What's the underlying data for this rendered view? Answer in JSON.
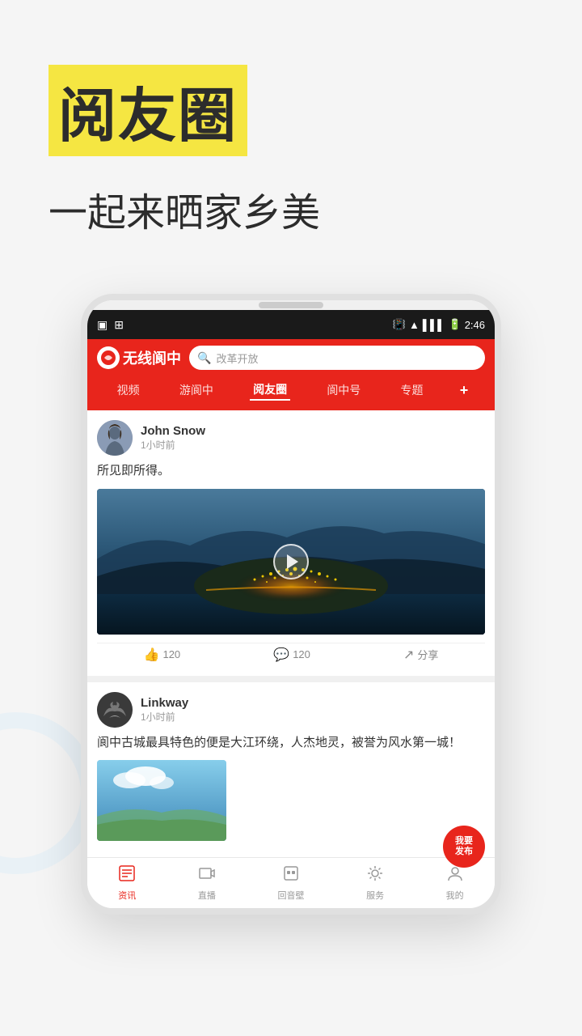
{
  "hero": {
    "title": "阅友圈",
    "subtitle": "一起来晒家乡美",
    "title_bg_color": "#f5e642"
  },
  "app": {
    "logo_text": "无线阆中",
    "search_placeholder": "改革开放"
  },
  "nav": {
    "tabs": [
      {
        "label": "视频",
        "active": false
      },
      {
        "label": "游阆中",
        "active": false
      },
      {
        "label": "阅友圈",
        "active": true
      },
      {
        "label": "阆中号",
        "active": false
      },
      {
        "label": "专题",
        "active": false
      }
    ],
    "plus_label": "+"
  },
  "status_bar": {
    "time": "2:46"
  },
  "posts": [
    {
      "username": "John Snow",
      "time": "1小时前",
      "content": "所见即所得。",
      "likes": "120",
      "comments": "120",
      "share": "分享",
      "has_video": true
    },
    {
      "username": "Linkway",
      "time": "1小时前",
      "content": "阆中古城最具特色的便是大江环绕，人杰地灵，被誉为风水第一城！",
      "has_image": true
    }
  ],
  "fab": {
    "label": "我要\n发布"
  },
  "bottom_nav": {
    "items": [
      {
        "label": "资讯",
        "active": true,
        "icon": "📄"
      },
      {
        "label": "直播",
        "active": false,
        "icon": "📺"
      },
      {
        "label": "回音壁",
        "active": false,
        "icon": "📦"
      },
      {
        "label": "服务",
        "active": false,
        "icon": "⚙️"
      },
      {
        "label": "我的",
        "active": false,
        "icon": "👤"
      }
    ]
  }
}
